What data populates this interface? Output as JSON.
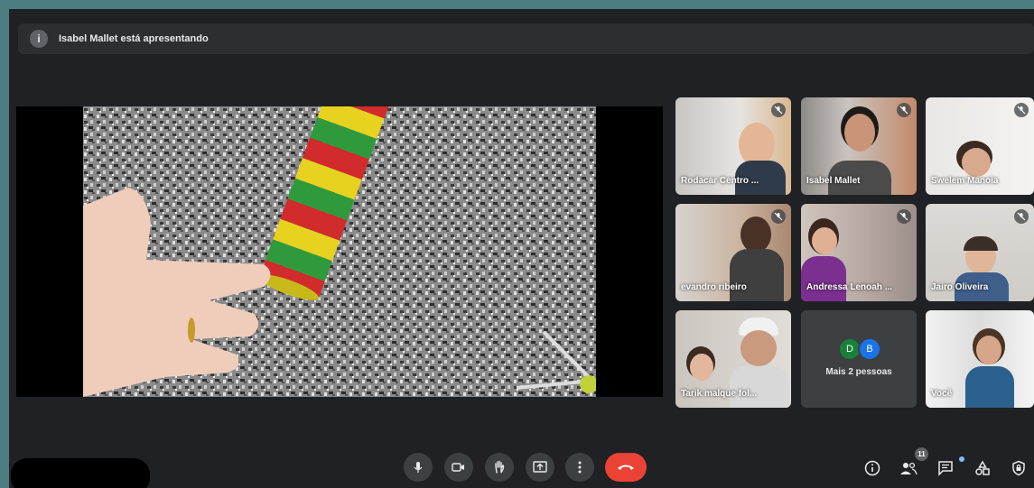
{
  "banner": {
    "text": "Isabel Mallet está apresentando"
  },
  "participants": [
    {
      "name": "Rodacar Centro ..."
    },
    {
      "name": "Isabel Mallet"
    },
    {
      "name": "Swelem Manoia"
    },
    {
      "name": "evandro ribeiro"
    },
    {
      "name": "Andressa Lenoah ..."
    },
    {
      "name": "Jairo Oliveira"
    },
    {
      "name": "Tarik malque fol..."
    },
    {
      "name": "Você"
    }
  ],
  "more_tile": {
    "avatar_1": "D",
    "avatar_2": "B",
    "label": "Mais 2 pessoas"
  },
  "people_count": "11",
  "colors": {
    "end_call": "#ea4335",
    "avatar_d": "#188038",
    "avatar_b": "#1a73e8"
  }
}
